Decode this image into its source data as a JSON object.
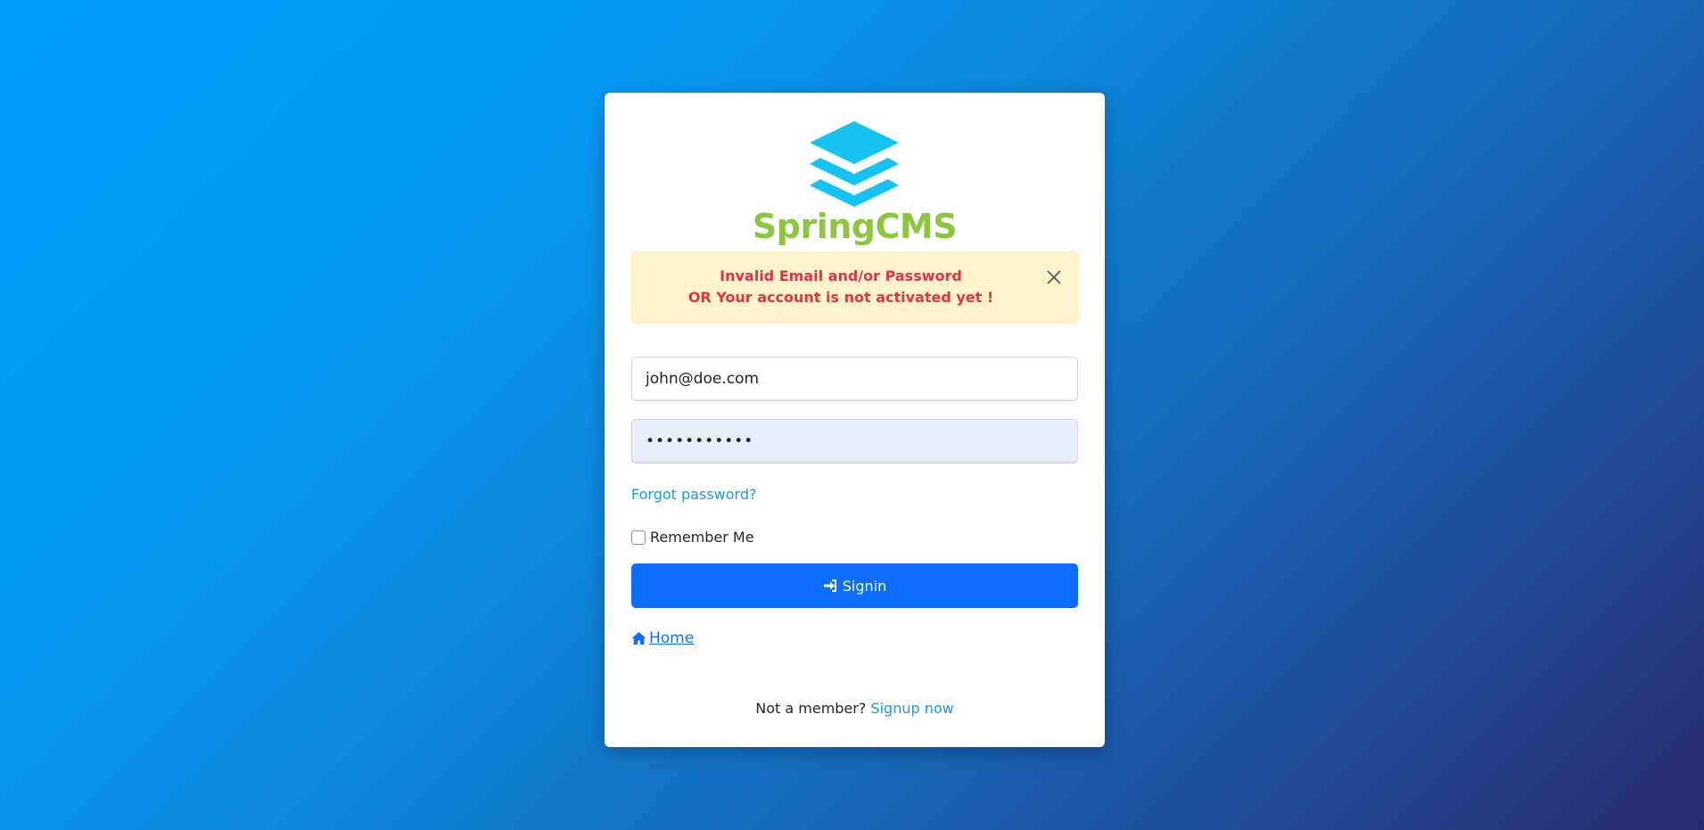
{
  "brand": {
    "name": "SpringCMS",
    "logo_icon": "layers-icon",
    "color": "#8cc63f",
    "logo_color": "#14c3ef"
  },
  "alert": {
    "line1": "Invalid Email and/or Password",
    "line2": "OR Your account is not activated yet !",
    "close_icon": "close-icon"
  },
  "form": {
    "email_value": "john@doe.com",
    "password_value": "•••••••••••",
    "forgot_label": "Forgot password?",
    "remember_label": "Remember Me",
    "signin_label": "Signin",
    "signin_icon": "sign-in-icon",
    "home_label": "Home",
    "home_icon": "home-icon"
  },
  "footer": {
    "prompt": "Not a member?",
    "signup_label": "Signup now"
  },
  "colors": {
    "primary": "#0d6efd",
    "alert_bg": "#fff3cd",
    "alert_text": "#dc3545",
    "link": "#1a9bd7"
  }
}
